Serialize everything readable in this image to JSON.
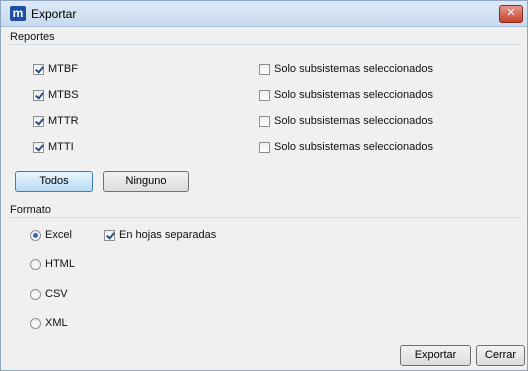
{
  "window": {
    "title": "Exportar",
    "app_icon_letter": "m",
    "close_glyph": "✕"
  },
  "reportes": {
    "label": "Reportes",
    "items": [
      {
        "label": "MTBF",
        "checked": true,
        "subsystems_label": "Solo subsistemas seleccionados",
        "subsystems_checked": false
      },
      {
        "label": "MTBS",
        "checked": true,
        "subsystems_label": "Solo subsistemas seleccionados",
        "subsystems_checked": false
      },
      {
        "label": "MTTR",
        "checked": true,
        "subsystems_label": "Solo subsistemas seleccionados",
        "subsystems_checked": false
      },
      {
        "label": "MTTI",
        "checked": true,
        "subsystems_label": "Solo subsistemas seleccionados",
        "subsystems_checked": false
      }
    ],
    "todos_label": "Todos",
    "ninguno_label": "Ninguno"
  },
  "formato": {
    "label": "Formato",
    "options": [
      {
        "label": "Excel",
        "selected": true
      },
      {
        "label": "HTML",
        "selected": false
      },
      {
        "label": "CSV",
        "selected": false
      },
      {
        "label": "XML",
        "selected": false
      }
    ],
    "separate_sheets_label": "En hojas separadas",
    "separate_sheets_checked": true
  },
  "footer": {
    "export_label": "Exportar",
    "close_label": "Cerrar"
  }
}
